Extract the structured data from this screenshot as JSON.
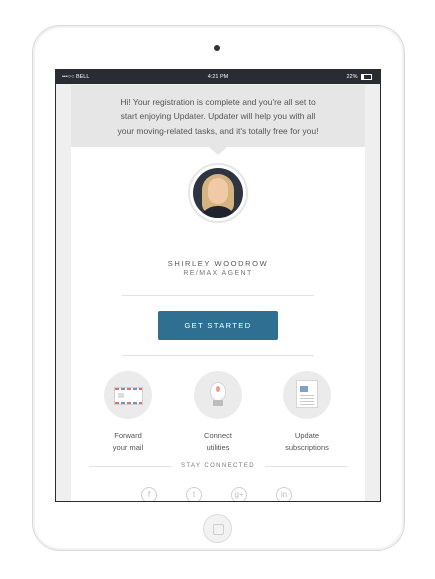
{
  "statusbar": {
    "carrier": "•••○○ BELL",
    "time": "4:21 PM",
    "battery": "22%"
  },
  "banner": {
    "line1": "Hi! Your registration is complete and you're all set to",
    "line2": "start enjoying Updater. Updater will help you with all",
    "line3": "your moving-related tasks, and it's totally free for you!"
  },
  "agent": {
    "name": "SHIRLEY WOODROW",
    "title": "RE/MAX AGENT"
  },
  "cta": {
    "label": "GET STARTED",
    "color": "#2f6f91"
  },
  "features": [
    {
      "line1": "Forward",
      "line2": "your mail",
      "icon": "envelope-icon"
    },
    {
      "line1": "Connect",
      "line2": "utilities",
      "icon": "lightbulb-icon"
    },
    {
      "line1": "Update",
      "line2": "subscriptions",
      "icon": "newspaper-icon"
    }
  ],
  "stay_connected": "STAY CONNECTED",
  "social": [
    {
      "icon": "facebook-icon",
      "glyph": "f"
    },
    {
      "icon": "twitter-icon",
      "glyph": "t"
    },
    {
      "icon": "googleplus-icon",
      "glyph": "g+"
    },
    {
      "icon": "linkedin-icon",
      "glyph": "in"
    }
  ]
}
